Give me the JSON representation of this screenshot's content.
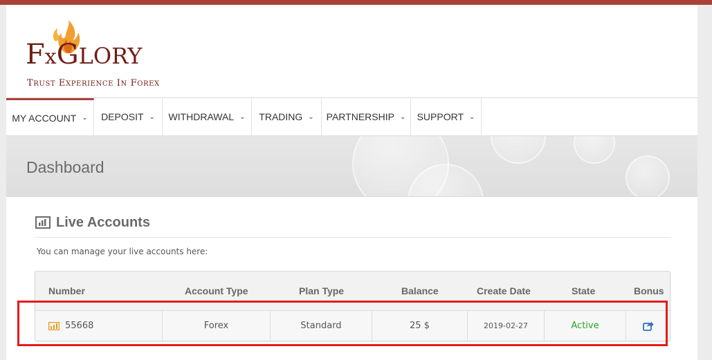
{
  "colors": {
    "brand": "#a8423a",
    "logo": "#6e1e14",
    "active_state": "#2aa32a",
    "account_icon": "#e8961f",
    "bonus_icon": "#2f6fc0",
    "highlight": "#e31b1b"
  },
  "logo": {
    "name": "FxGlory",
    "tagline": "Trust Experience In Forex"
  },
  "nav": {
    "items": [
      {
        "label": "MY ACCOUNT"
      },
      {
        "label": "DEPOSIT"
      },
      {
        "label": "WITHDRAWAL"
      },
      {
        "label": "TRADING"
      },
      {
        "label": "PARTNERSHIP"
      },
      {
        "label": "SUPPORT"
      }
    ]
  },
  "banner": {
    "title": "Dashboard"
  },
  "live_accounts": {
    "title": "Live Accounts",
    "description": "You can manage your live accounts here:",
    "columns": [
      "Number",
      "Account Type",
      "Plan Type",
      "Balance",
      "Create Date",
      "State",
      "Bonus"
    ],
    "rows": [
      {
        "number": "55668",
        "account_type": "Forex",
        "plan_type": "Standard",
        "balance": "25 $",
        "create_date": "2019-02-27",
        "state": "Active",
        "bonus_icon": "share-icon"
      }
    ]
  }
}
